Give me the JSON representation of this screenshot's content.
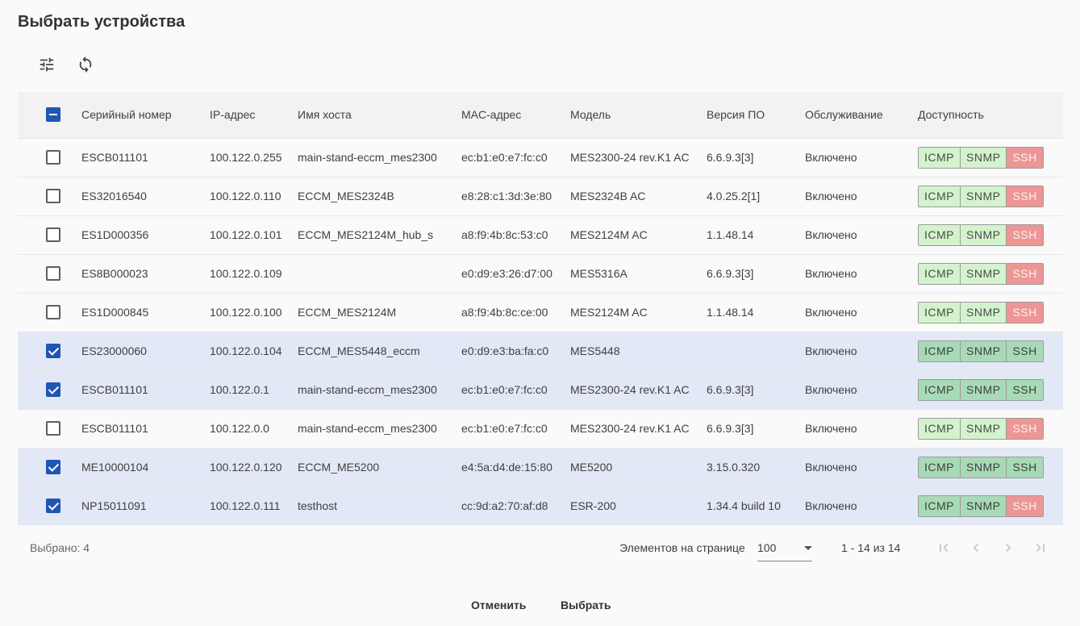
{
  "dialog": {
    "title": "Выбрать устройства"
  },
  "toolbar": {
    "filter_icon": "tune-icon",
    "refresh_icon": "refresh-icon"
  },
  "table": {
    "columns": [
      "Серийный номер",
      "IP-адрес",
      "Имя хоста",
      "MAC-адрес",
      "Модель",
      "Версия ПО",
      "Обслуживание",
      "Доступность"
    ],
    "header_checkbox": "indeterminate",
    "rows": [
      {
        "checked": false,
        "serial": "ESCB011101",
        "ip": "100.122.0.255",
        "host": "main-stand-eccm_mes2300",
        "mac": "ec:b1:e0:e7:fc:c0",
        "model": "MES2300-24 rev.K1 AC",
        "fw": "6.6.9.3[3]",
        "service": "Включено",
        "icmp": "ok-light",
        "snmp": "ok-light",
        "ssh": "fail"
      },
      {
        "checked": false,
        "serial": "ES32016540",
        "ip": "100.122.0.110",
        "host": "ECCM_MES2324B",
        "mac": "e8:28:c1:3d:3e:80",
        "model": "MES2324B AC",
        "fw": "4.0.25.2[1]",
        "service": "Включено",
        "icmp": "ok-light",
        "snmp": "ok-light",
        "ssh": "fail"
      },
      {
        "checked": false,
        "serial": "ES1D000356",
        "ip": "100.122.0.101",
        "host": "ECCM_MES2124M_hub_s",
        "mac": "a8:f9:4b:8c:53:c0",
        "model": "MES2124M AC",
        "fw": "1.1.48.14",
        "service": "Включено",
        "icmp": "ok-light",
        "snmp": "ok-light",
        "ssh": "fail"
      },
      {
        "checked": false,
        "serial": "ES8B000023",
        "ip": "100.122.0.109",
        "host": "",
        "mac": "e0:d9:e3:26:d7:00",
        "model": "MES5316A",
        "fw": "6.6.9.3[3]",
        "service": "Включено",
        "icmp": "ok-light",
        "snmp": "ok-light",
        "ssh": "fail"
      },
      {
        "checked": false,
        "serial": "ES1D000845",
        "ip": "100.122.0.100",
        "host": "ECCM_MES2124M",
        "mac": "a8:f9:4b:8c:ce:00",
        "model": "MES2124M AC",
        "fw": "1.1.48.14",
        "service": "Включено",
        "icmp": "ok-light",
        "snmp": "ok-light",
        "ssh": "fail"
      },
      {
        "checked": true,
        "serial": "ES23000060",
        "ip": "100.122.0.104",
        "host": "ECCM_MES5448_eccm",
        "mac": "e0:d9:e3:ba:fa:c0",
        "model": "MES5448",
        "fw": "",
        "service": "Включено",
        "icmp": "ok",
        "snmp": "ok",
        "ssh": "ok"
      },
      {
        "checked": true,
        "serial": "ESCB011101",
        "ip": "100.122.0.1",
        "host": "main-stand-eccm_mes2300",
        "mac": "ec:b1:e0:e7:fc:c0",
        "model": "MES2300-24 rev.K1 AC",
        "fw": "6.6.9.3[3]",
        "service": "Включено",
        "icmp": "ok",
        "snmp": "ok",
        "ssh": "ok"
      },
      {
        "checked": false,
        "serial": "ESCB011101",
        "ip": "100.122.0.0",
        "host": "main-stand-eccm_mes2300",
        "mac": "ec:b1:e0:e7:fc:c0",
        "model": "MES2300-24 rev.K1 AC",
        "fw": "6.6.9.3[3]",
        "service": "Включено",
        "icmp": "ok-light",
        "snmp": "ok-light",
        "ssh": "fail"
      },
      {
        "checked": true,
        "serial": "ME10000104",
        "ip": "100.122.0.120",
        "host": "ECCM_ME5200",
        "mac": "e4:5a:d4:de:15:80",
        "model": "ME5200",
        "fw": "3.15.0.320",
        "service": "Включено",
        "icmp": "ok",
        "snmp": "ok",
        "ssh": "ok"
      },
      {
        "checked": true,
        "serial": "NP15011091",
        "ip": "100.122.0.111",
        "host": "testhost",
        "mac": "cc:9d:a2:70:af:d8",
        "model": "ESR-200",
        "fw": "1.34.4 build 10",
        "service": "Включено",
        "icmp": "ok",
        "snmp": "ok",
        "ssh": "fail"
      }
    ],
    "availability_labels": {
      "icmp": "ICMP",
      "snmp": "SNMP",
      "ssh": "SSH"
    }
  },
  "footer": {
    "selected_text": "Выбрано: 4",
    "per_page_label": "Элементов на странице",
    "per_page_value": "100",
    "range_text": "1 - 14 из 14"
  },
  "actions": {
    "cancel_label": "Отменить",
    "select_label": "Выбрать"
  },
  "colors": {
    "accent": "#1f56b4",
    "selected_row": "#e2e8f6",
    "status_ok": "#a8dab7",
    "status_ok_light": "#d3f3cc",
    "status_fail": "#ee9595"
  }
}
